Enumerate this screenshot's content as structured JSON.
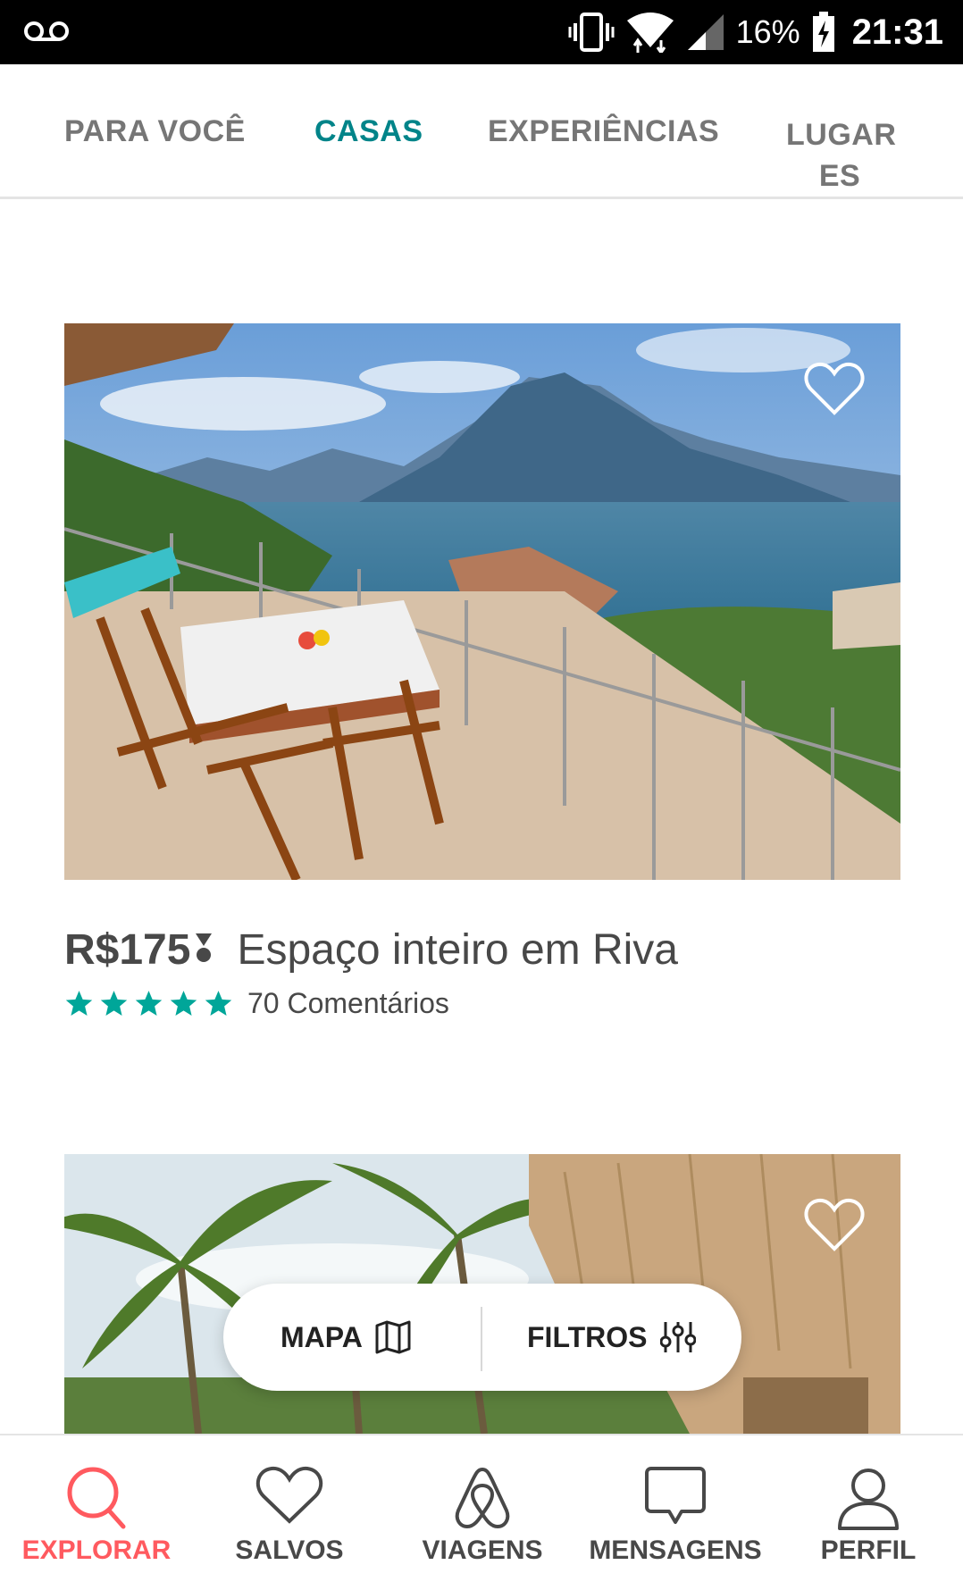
{
  "status_bar": {
    "battery": "16%",
    "time": "21:31",
    "icons": [
      "voicemail-icon",
      "vibrate-icon",
      "wifi-icon",
      "signal-icon",
      "battery-charging-icon"
    ]
  },
  "top_tabs": [
    {
      "label": "PARA VOCÊ",
      "active": false
    },
    {
      "label": "CASAS",
      "active": true
    },
    {
      "label": "EXPERIÊNCIAS",
      "active": false
    },
    {
      "label": "LUGAR\nES",
      "active": false
    }
  ],
  "listings": [
    {
      "photo": "lake-balcony-photo",
      "price": "R$175",
      "title": "Espaço inteiro em Riva",
      "rating": 5,
      "reviews": "70 Comentários",
      "saved": false
    },
    {
      "photo": "palm-hut-photo",
      "saved": false
    }
  ],
  "floating_actions": {
    "map_label": "MAPA",
    "filters_label": "FILTROS"
  },
  "bottom_nav": [
    {
      "label": "EXPLORAR",
      "icon": "search-icon",
      "active": true
    },
    {
      "label": "SALVOS",
      "icon": "heart-icon",
      "active": false
    },
    {
      "label": "VIAGENS",
      "icon": "airbnb-logo-icon",
      "active": false
    },
    {
      "label": "MENSAGENS",
      "icon": "message-icon",
      "active": false
    },
    {
      "label": "PERFIL",
      "icon": "profile-icon",
      "active": false
    }
  ],
  "colors": {
    "accent_teal": "#008489",
    "explore_red": "#FF5A5F",
    "star_teal": "#00A699",
    "text_dark": "#484848"
  }
}
